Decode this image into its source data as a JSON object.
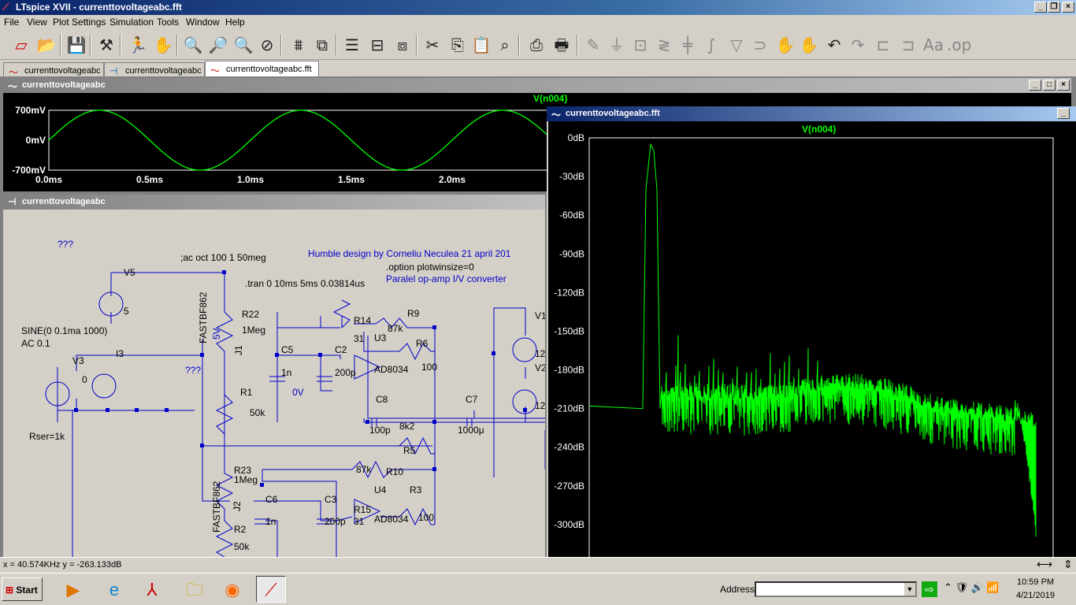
{
  "app": {
    "title": "LTspice XVII - currenttovoltageabc.fft"
  },
  "menu": [
    "File",
    "View",
    "Plot Settings",
    "Simulation",
    "Tools",
    "Window",
    "Help"
  ],
  "tabs": [
    {
      "label": "currenttovoltageabc"
    },
    {
      "label": "currenttovoltageabc"
    },
    {
      "label": "currenttovoltageabc.fft"
    }
  ],
  "waveform_window": {
    "title": "currenttovoltageabc",
    "trace": "V(n004)",
    "y_ticks": [
      "700mV",
      "0mV",
      "-700mV"
    ],
    "x_ticks": [
      "0.0ms",
      "0.5ms",
      "1.0ms",
      "1.5ms",
      "2.0ms",
      "2"
    ]
  },
  "schematic_window": {
    "title": "currenttovoltageabc"
  },
  "schematic": {
    "unknown": "???",
    "ac_directive": ";ac oct 100 1 50meg",
    "credit": "Humble design by Corneliu Neculea 21 april 201",
    "option": ".option plotwinsize=0",
    "tran": ".tran 0 10ms 5ms 0.03814us",
    "desc": "Paralel op-amp I/V converter",
    "sine": "SINE(0 0.1ma 1000)",
    "ac": "AC 0.1",
    "rser": "Rser=1k",
    "labels": {
      "V5": "V5",
      "v5val": "5",
      "R22": "R22",
      "R22v": "1Meg",
      "J1": "J1",
      "jfet": "FASTBF862",
      "vv5": "5V",
      "R14": "R14",
      "r14v": "31",
      "R9": "R9",
      "r9v": "87k",
      "U3": "U3",
      "ad": "AD8034",
      "R6": "R6",
      "r6v": "100",
      "C5": "C5",
      "c5v": "1n",
      "C2": "C2",
      "c2v": "200p",
      "R1": "R1",
      "r1v": "50k",
      "zv": "0V",
      "C8": "C8",
      "c8v": "100p",
      "C7": "C7",
      "c7v": "1000μ",
      "k82": "8k2",
      "R5": "R5",
      "R23": "R23",
      "r23v": "1Meg",
      "J2": "J2",
      "jfet2": "FASTBF862",
      "C6": "C6",
      "c6v": "1n",
      "C3": "C3",
      "c3v": "200p",
      "R15": "R15",
      "r15v": "31",
      "U4": "U4",
      "ad2": "AD8034",
      "R3": "R3",
      "r3v": "100",
      "R10": "R10",
      "r10v": "87k",
      "R2": "R2",
      "r2v": "50k",
      "V3": "V3",
      "v3v": "0",
      "I3": "I3",
      "V1": "V1",
      "v1v": "12",
      "V2": "V2",
      "v2v": "12",
      "u2": "???"
    }
  },
  "fft_window": {
    "title": "currenttovoltageabc.fft",
    "trace": "V(n004)",
    "y_ticks": [
      "0dB",
      "-30dB",
      "-60dB",
      "-90dB",
      "-120dB",
      "-150dB",
      "-180dB",
      "-210dB",
      "-240dB",
      "-270dB",
      "-300dB"
    ]
  },
  "status": {
    "cursor": "x = 40.574KHz   y = -263.133dB"
  },
  "taskbar": {
    "start": "Start",
    "address_label": "Address",
    "time": "10:59 PM",
    "date": "4/21/2019"
  },
  "chart_data": [
    {
      "type": "line",
      "series": [
        {
          "name": "V(n004)",
          "description_free": true
        }
      ],
      "ylim": [
        -700,
        700
      ],
      "xlim": [
        0,
        2.5
      ],
      "x_ticks": [
        0,
        0.5,
        1.0,
        1.5,
        2.0
      ],
      "ytick_values": [
        700,
        0,
        -700
      ],
      "frequency_khz": 1,
      "amplitude_mv": 700
    },
    {
      "type": "line",
      "series": [
        {
          "name": "V(n004)"
        }
      ],
      "ylim": [
        -300,
        0
      ],
      "fundamental_db": -5,
      "noise_floor_db": -210
    }
  ]
}
